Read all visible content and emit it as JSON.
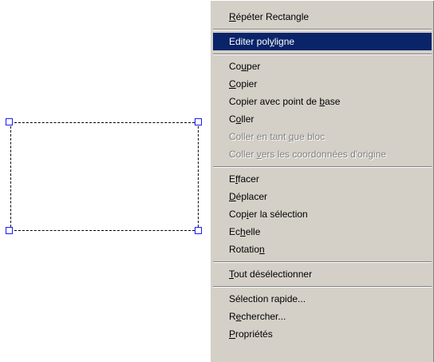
{
  "colors": {
    "menu_bg": "#d4d0c8",
    "highlight_bg": "#0a246a",
    "highlight_text": "#ffffff",
    "disabled_text": "#808080",
    "grip_blue": "#1a1aff"
  },
  "canvas": {
    "selected_object": "rectangle",
    "grip_icon": "grip-square-icon"
  },
  "menu": {
    "groups": [
      {
        "items": [
          {
            "label": "Répéter Rectangle",
            "mnemonic": "R"
          }
        ]
      },
      {
        "items": [
          {
            "label": "Editer polyligne",
            "mnemonic": "y",
            "selected": true
          }
        ]
      },
      {
        "items": [
          {
            "label": "Couper",
            "mnemonic": "u"
          },
          {
            "label": "Copier",
            "mnemonic": "C"
          },
          {
            "label": "Copier avec point de base",
            "mnemonic": "b"
          },
          {
            "label": "Coller",
            "mnemonic": "o"
          },
          {
            "label": "Coller en tant que bloc",
            "mnemonic": "q",
            "disabled": true
          },
          {
            "label": "Coller vers les coordonnées d'origine",
            "mnemonic": "v",
            "disabled": true
          }
        ]
      },
      {
        "items": [
          {
            "label": "Effacer",
            "mnemonic": "f"
          },
          {
            "label": "Déplacer",
            "mnemonic": "D"
          },
          {
            "label": "Copier la sélection",
            "mnemonic": "i"
          },
          {
            "label": "Echelle",
            "mnemonic": "h"
          },
          {
            "label": "Rotation",
            "mnemonic": "n"
          }
        ]
      },
      {
        "items": [
          {
            "label": "Tout désélectionner",
            "mnemonic": "T"
          }
        ]
      },
      {
        "items": [
          {
            "label": "Sélection rapide...",
            "mnemonic": "g"
          },
          {
            "label": "Rechercher...",
            "mnemonic": "e"
          },
          {
            "label": "Propriétés",
            "mnemonic": "P"
          }
        ]
      }
    ]
  }
}
